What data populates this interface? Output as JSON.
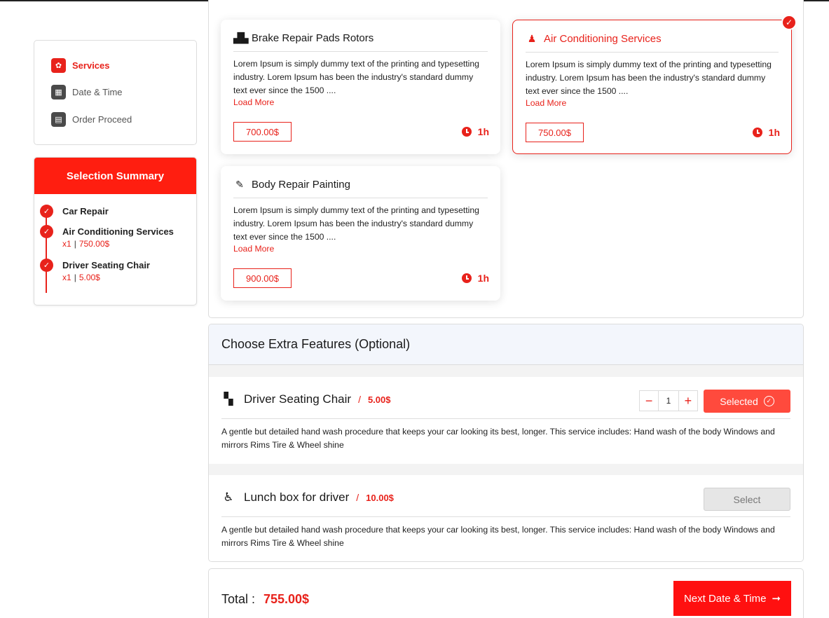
{
  "steps": [
    {
      "label": "Services",
      "icon": "wrench-icon",
      "active": true
    },
    {
      "label": "Date & Time",
      "icon": "calendar-icon",
      "active": false
    },
    {
      "label": "Order Proceed",
      "icon": "document-icon",
      "active": false
    }
  ],
  "summary": {
    "title": "Selection Summary",
    "items": [
      {
        "name": "Car Repair"
      },
      {
        "name": "Air Conditioning Services",
        "qty": "x1",
        "price": "750.00$"
      },
      {
        "name": "Driver Seating Chair",
        "qty": "x1",
        "price": "5.00$"
      }
    ]
  },
  "services": [
    {
      "title": "Brake Repair Pads Rotors",
      "icon": "car-parts-icon",
      "desc": "Lorem Ipsum is simply dummy text of the printing and typesetting industry. Lorem Ipsum has been the industry's standard dummy text ever since the 1500 ....",
      "more": "Load More",
      "price": "700.00$",
      "duration": "1h"
    },
    {
      "title": "Air Conditioning Services",
      "icon": "technician-icon",
      "desc": "Lorem Ipsum is simply dummy text of the printing and typesetting industry. Lorem Ipsum has been the industry's standard dummy text ever since the 1500 ....",
      "more": "Load More",
      "price": "750.00$",
      "duration": "1h",
      "selected": true
    },
    {
      "title": "Body Repair Painting",
      "icon": "paint-brush-icon",
      "desc": "Lorem Ipsum is simply dummy text of the printing and typesetting industry. Lorem Ipsum has been the industry's standard dummy text ever since the 1500 ....",
      "more": "Load More",
      "price": "900.00$",
      "duration": "1h"
    }
  ],
  "extras": {
    "title": "Choose Extra Features (Optional)",
    "items": [
      {
        "name": "Driver Seating Chair",
        "icon": "chairs-icon",
        "slash": "/",
        "price": "5.00$",
        "qty": "1",
        "button": "Selected",
        "desc": "A gentle but detailed hand wash procedure that keeps your car looking its best, longer. This service includes: Hand wash of the body Windows and mirrors Rims Tire & Wheel shine"
      },
      {
        "name": "Lunch box for driver",
        "icon": "wheelchair-icon",
        "slash": "/",
        "price": "10.00$",
        "button": "Select",
        "desc": "A gentle but detailed hand wash procedure that keeps your car looking its best, longer. This service includes: Hand wash of the body Windows and mirrors Rims Tire & Wheel shine"
      }
    ]
  },
  "total": {
    "label": "Total :",
    "value": "755.00$",
    "next_label": "Next Date & Time"
  },
  "colors": {
    "accent": "#e8221b",
    "header_red": "#ff1e10",
    "selected_button": "#ff4a3d"
  }
}
